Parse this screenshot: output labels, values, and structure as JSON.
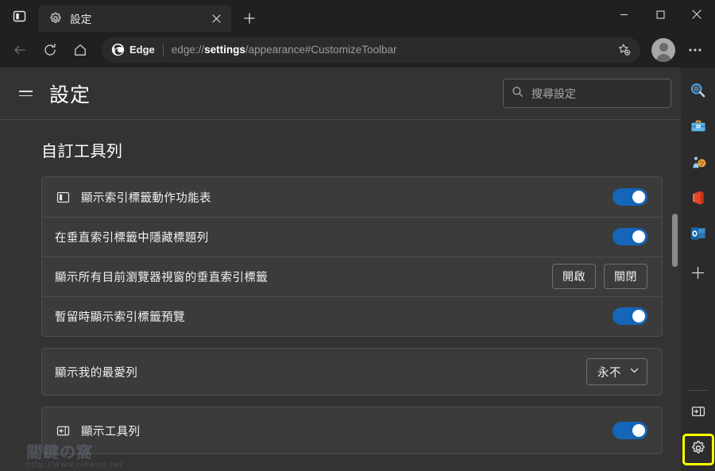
{
  "window": {
    "tab_search_icon": "tab-search-icon",
    "minimize_label": "最小化",
    "maximize_label": "最大化",
    "close_label": "關閉"
  },
  "tabs": [
    {
      "favicon": "gear-icon",
      "title": "設定",
      "close_label": "×"
    }
  ],
  "newtab_label": "+",
  "toolbar": {
    "back_label": "←",
    "refresh_label": "⟳",
    "home_label": "⌂",
    "edge_chip_label": "Edge",
    "url_prefix": "edge://",
    "url_bold": "settings",
    "url_suffix": "/appearance#CustomizeToolbar",
    "url_full": "edge://settings/appearance#CustomizeToolbar",
    "favorite_icon": "star-plus-icon",
    "avatar_icon": "profile-avatar",
    "more_label": "…"
  },
  "settings": {
    "menu_label": "功能表",
    "title": "設定",
    "search": {
      "placeholder": "搜尋設定",
      "value": "",
      "icon": "search-icon"
    },
    "section_title": "自訂工具列",
    "cards": [
      {
        "rows": [
          {
            "icon": "vertical-tabs-icon",
            "label": "顯示索引標籤動作功能表",
            "control": "toggle",
            "toggle_on": true
          },
          {
            "icon": null,
            "label": "在垂直索引標籤中隱藏標題列",
            "control": "toggle",
            "toggle_on": true
          },
          {
            "icon": null,
            "label": "顯示所有目前瀏覽器視窗的垂直索引標籤",
            "control": "buttons",
            "buttons": [
              "開啟",
              "關閉"
            ]
          },
          {
            "icon": null,
            "label": "暫留時顯示索引標籤預覽",
            "control": "toggle",
            "toggle_on": true
          }
        ]
      },
      {
        "rows": [
          {
            "icon": null,
            "label": "顯示我的最愛列",
            "control": "dropdown",
            "dropdown_value": "永不"
          }
        ]
      },
      {
        "rows": [
          {
            "icon": "show-toolbar-icon",
            "label": "顯示工具列",
            "control": "toggle",
            "toggle_on": true
          }
        ]
      }
    ]
  },
  "sidebar": {
    "items": [
      {
        "name": "sidebar-search",
        "icon": "search-icon",
        "label": "搜尋"
      },
      {
        "name": "sidebar-tools",
        "icon": "toolbox-icon",
        "label": "工具"
      },
      {
        "name": "sidebar-games",
        "icon": "games-icon",
        "label": "遊戲"
      },
      {
        "name": "sidebar-office",
        "icon": "office-icon",
        "label": "Office"
      },
      {
        "name": "sidebar-outlook",
        "icon": "outlook-icon",
        "label": "Outlook"
      },
      {
        "name": "sidebar-add",
        "icon": "plus-icon",
        "label": "新增"
      }
    ],
    "bottom": [
      {
        "name": "sidebar-toggle-pane",
        "icon": "expand-pane-icon",
        "label": "展開"
      },
      {
        "name": "sidebar-settings",
        "icon": "gear-icon",
        "label": "設定",
        "highlighted": true
      }
    ],
    "highlight_color": "#ffff00"
  },
  "colors": {
    "accent_toggle": "#1565b8",
    "window_bg": "#202020",
    "page_bg": "#333333",
    "card_bg": "#3b3b3b",
    "sidebar_bg": "#2b2b2b",
    "highlight": "#ffff00"
  },
  "watermark": {
    "logo": "關鍵の窩",
    "url": "http://www.cinwoo.tw/"
  }
}
